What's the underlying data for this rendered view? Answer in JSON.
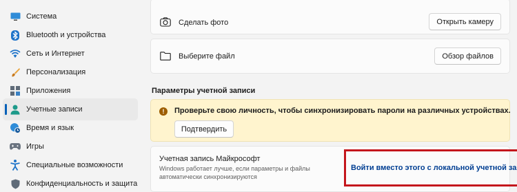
{
  "sidebar": {
    "items": [
      {
        "label": "Система",
        "icon": "monitor-icon"
      },
      {
        "label": "Bluetooth и устройства",
        "icon": "bluetooth-icon"
      },
      {
        "label": "Сеть и Интернет",
        "icon": "wifi-icon"
      },
      {
        "label": "Персонализация",
        "icon": "brush-icon"
      },
      {
        "label": "Приложения",
        "icon": "apps-icon"
      },
      {
        "label": "Учетные записи",
        "icon": "person-icon",
        "active": true
      },
      {
        "label": "Время и язык",
        "icon": "globe-clock-icon"
      },
      {
        "label": "Игры",
        "icon": "gamepad-icon"
      },
      {
        "label": "Специальные возможности",
        "icon": "accessibility-icon"
      },
      {
        "label": "Конфиденциальность и защита",
        "icon": "shield-icon"
      }
    ]
  },
  "photo_row": {
    "label": "Сделать фото",
    "button": "Открыть камеру"
  },
  "file_row": {
    "label": "Выберите файл",
    "button": "Обзор файлов"
  },
  "account_settings": {
    "title": "Параметры учетной записи"
  },
  "verify": {
    "message": "Проверьте свою личность, чтобы синхронизировать пароли на различных устройствах.",
    "button": "Подтвердить"
  },
  "microsoft_account": {
    "title": "Учетная запись Майкрософт",
    "description": "Windows работает лучше, если параметры и файлы автоматически синхронизируются",
    "link": "Войти вместо этого с локальной учетной записью"
  },
  "colors": {
    "accent": "#005fb8",
    "warning_bg": "#fff4ce",
    "highlight_border": "#c4161c",
    "link": "#003e92"
  }
}
